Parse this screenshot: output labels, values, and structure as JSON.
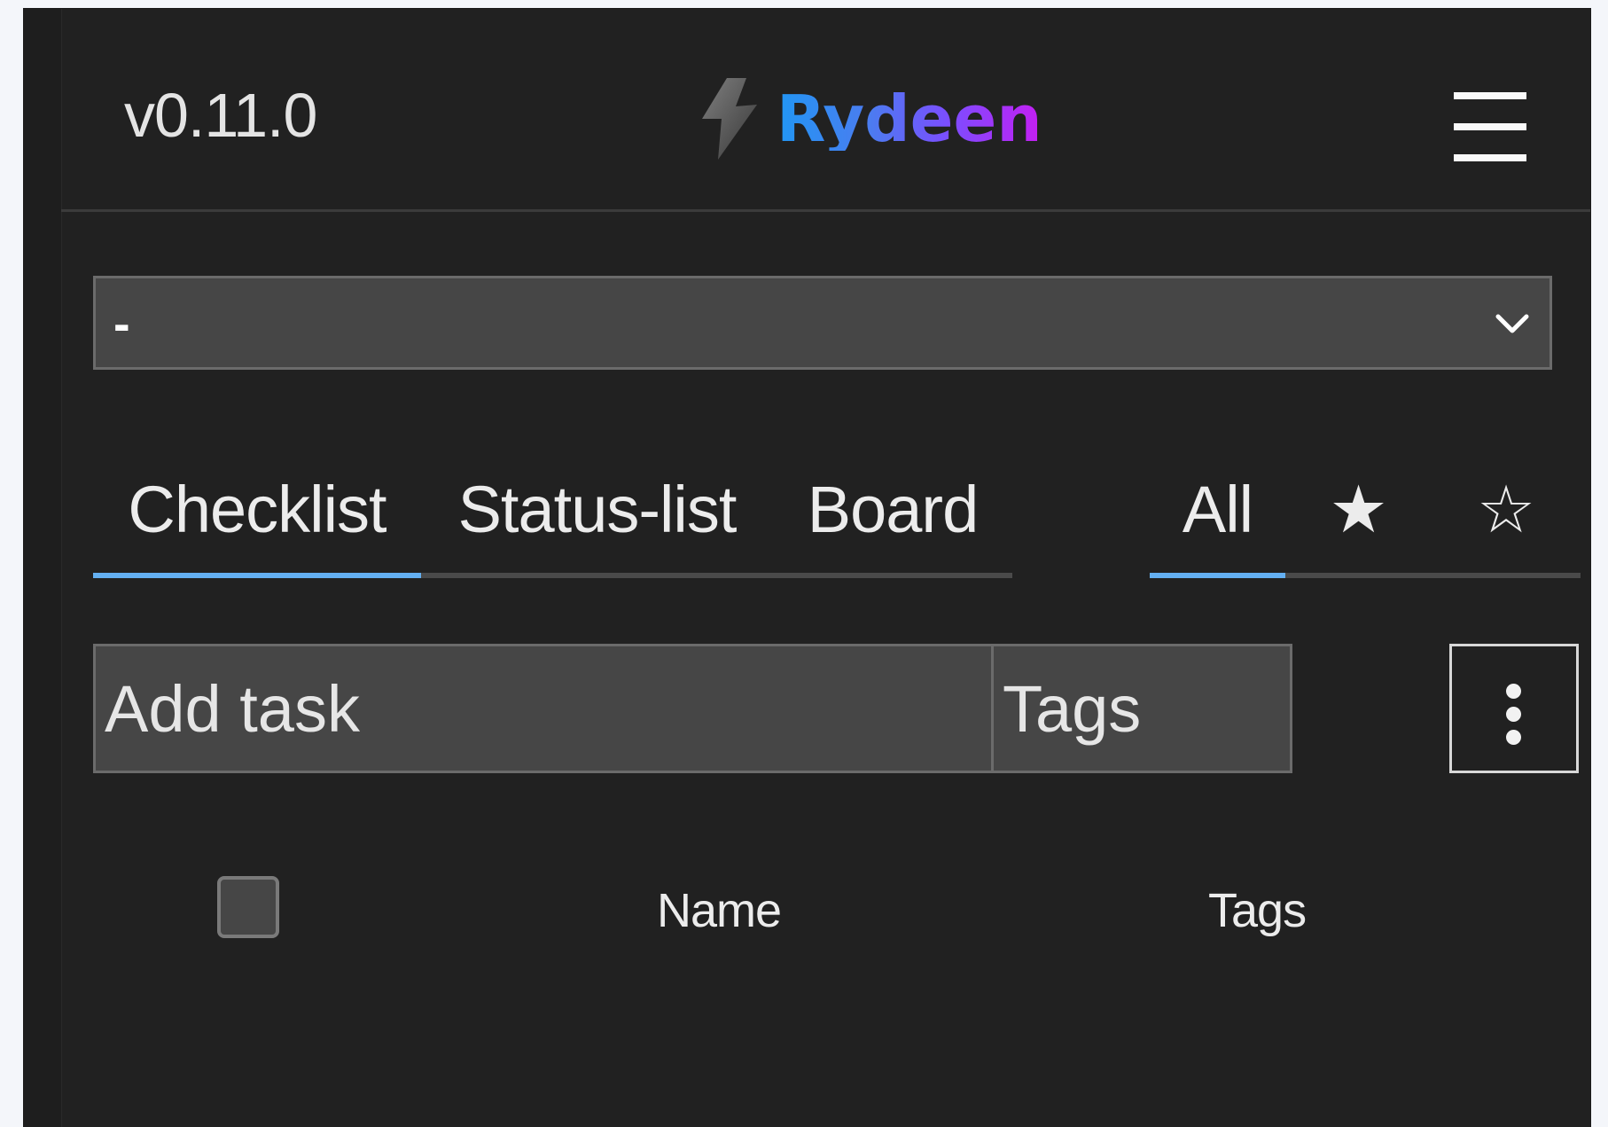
{
  "header": {
    "version": "v0.11.0",
    "brand": "Rydeen",
    "logo_icon": "lightning-bolt-icon",
    "menu_icon": "hamburger-menu-icon"
  },
  "list_select": {
    "value": "-",
    "icon": "chevron-down-icon"
  },
  "view_tabs": {
    "active": "Checklist",
    "items": [
      {
        "label": "Checklist"
      },
      {
        "label": "Status-list"
      },
      {
        "label": "Board"
      }
    ]
  },
  "filter_tabs": {
    "active": "All",
    "items": [
      {
        "label": "All"
      },
      {
        "label": "★",
        "icon": "star-filled-icon"
      },
      {
        "label": "☆",
        "icon": "star-outline-icon"
      }
    ]
  },
  "task_input": {
    "placeholder": "Add task",
    "tags_placeholder": "Tags",
    "more_icon": "more-vertical-icon"
  },
  "table": {
    "columns": [
      "Name",
      "Tags"
    ]
  },
  "colors": {
    "background": "#212121",
    "active_tab": "#64b0f2",
    "brand_gradient": [
      "#2196f3",
      "#7c4dff",
      "#c51ef2"
    ]
  }
}
